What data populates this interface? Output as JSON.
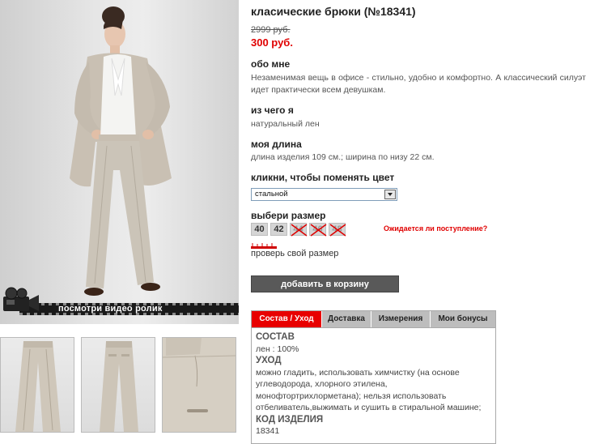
{
  "product": {
    "title": "класические брюки (№18341)",
    "old_price": "2999 руб.",
    "new_price": "300 руб.",
    "about_title": "обо мне",
    "about_text": "Незаменимая вещь в офисе - стильно, удобно и комфортно. А классический силуэт идет практически всем девушкам.",
    "material_title": "из чего я",
    "material_text": "натуральный лен",
    "length_title": "моя длина",
    "length_text": "длина изделия 109 см.; ширина по низу 22 см.",
    "color_title": "кликни, чтобы поменять цвет",
    "color_selected": "стальной",
    "size_title": "выбери размер",
    "sizes": [
      {
        "label": "40",
        "available": true
      },
      {
        "label": "42",
        "available": true
      },
      {
        "label": "44",
        "available": false
      },
      {
        "label": "46",
        "available": false
      },
      {
        "label": "48",
        "available": false
      }
    ],
    "arrival_link": "Ожидается ли поступление?",
    "check_size": "проверь свой размер",
    "add_to_cart": "добавить в корзину"
  },
  "video": {
    "label": "посмотри видео ролик"
  },
  "tabs": {
    "items": [
      "Состав / Уход",
      "Доставка",
      "Измерения",
      "Мои бонусы"
    ],
    "active": "Состав / Уход"
  },
  "details": {
    "composition_title": "СОСТАВ",
    "composition_text": "лен : 100%",
    "care_title": "УХОД",
    "care_text": "можно гладить, использовать химчистку (на основе углеводорода, хлорного этилена, монофтортрихлорметана); нельзя использовать отбеливатель,выжимать и сушить в стиральной машине;",
    "code_title": "КОД ИЗДЕЛИЯ",
    "code_text": "18341"
  },
  "colors": {
    "accent": "#e80000",
    "price": "#e00000",
    "button": "#595959"
  }
}
